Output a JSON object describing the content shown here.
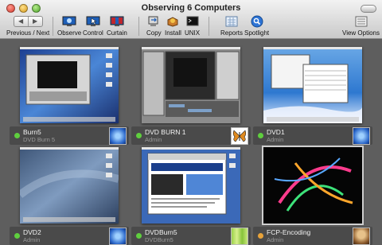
{
  "window": {
    "title": "Observing 6 Computers"
  },
  "toolbar": {
    "prev_next": "Previous / Next",
    "observe": "Observe",
    "control": "Control",
    "curtain": "Curtain",
    "copy": "Copy",
    "install": "Install",
    "unix": "UNIX",
    "reports": "Reports",
    "spotlight": "Spotlight",
    "view_options": "View Options"
  },
  "computers": [
    {
      "name": "Burn5",
      "subtitle": "DVD Burn 5",
      "status_color": "#5fcf3e",
      "picture_icon": "blue-snowflake-icon"
    },
    {
      "name": "DVD BURN 1",
      "subtitle": "Admin",
      "status_color": "#5fcf3e",
      "picture_icon": "butterfly-icon"
    },
    {
      "name": "DVD1",
      "subtitle": "Admin",
      "status_color": "#5fcf3e",
      "picture_icon": "blue-snowflake-icon"
    },
    {
      "name": "DVD2",
      "subtitle": "Admin",
      "status_color": "#5fcf3e",
      "picture_icon": "blue-snowflake-icon"
    },
    {
      "name": "DVDBurn5",
      "subtitle": "DVDBurn5",
      "status_color": "#5fcf3e",
      "picture_icon": "bamboo-icon"
    },
    {
      "name": "FCP-Encoding",
      "subtitle": "Admin",
      "status_color": "#e8a33a",
      "picture_icon": "dog-icon"
    }
  ]
}
